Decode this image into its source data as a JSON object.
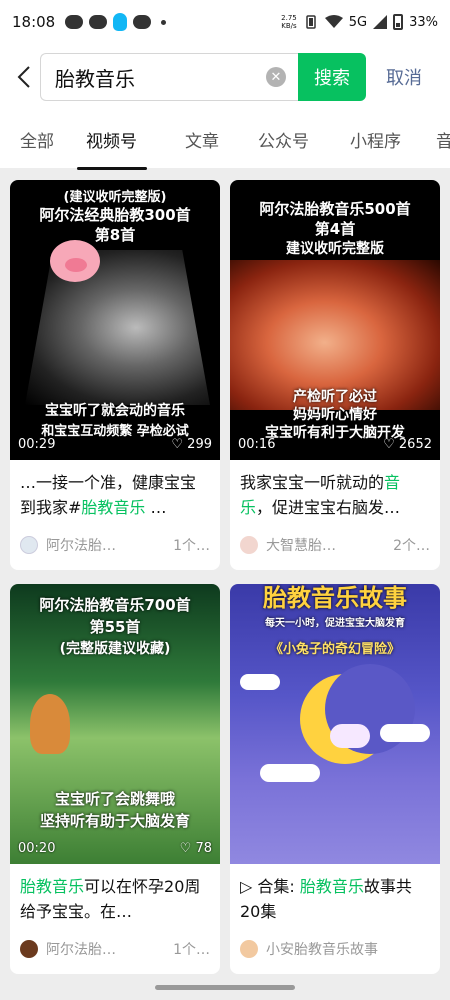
{
  "status": {
    "time": "18:08",
    "speed_top": "2.75",
    "speed_bottom": "KB/s",
    "net": "5G",
    "battery": "33%"
  },
  "search": {
    "query": "胎教音乐",
    "button": "搜索",
    "cancel": "取消"
  },
  "tabs": [
    "全部",
    "视频号",
    "文章",
    "公众号",
    "小程序",
    "音"
  ],
  "active_tab": "视频号",
  "cards": [
    {
      "caption1": "(建议收听完整版)",
      "caption2": "阿尔法经典胎教300首",
      "caption3": "第8首",
      "bottom1": "宝宝听了就会动的音乐",
      "bottom2": "和宝宝互动频繁 孕检必试",
      "duration": "00:29",
      "likes": "299",
      "desc_pre": "…一接一个准，健康宝宝到我家#",
      "desc_hl": "胎教音乐",
      "desc_post": " …",
      "author": "阿尔法胎…",
      "count": "1个…"
    },
    {
      "caption1": "阿尔法胎教音乐500首",
      "caption2": "第4首",
      "caption3": "建议收听完整版",
      "bottom1": "产检听了必过",
      "bottom2": "妈妈听心情好",
      "bottom3": "宝宝听有利于大脑开发",
      "duration": "00:16",
      "likes": "2652",
      "desc_pre": "我家宝宝一听就动的",
      "desc_hl": "音乐",
      "desc_post": "，促进宝宝右脑发…",
      "author": "大智慧胎…",
      "count": "2个…"
    },
    {
      "caption1": "阿尔法胎教音乐700首",
      "caption2": "第55首",
      "caption3": "(完整版建议收藏)",
      "bottom1": "宝宝听了会跳舞哦",
      "bottom2": "坚持听有助于大脑发育",
      "duration": "00:20",
      "likes": "78",
      "desc_pre": "",
      "desc_hl": "胎教音乐",
      "desc_post": "可以在怀孕20周给予宝宝。在…",
      "author": "阿尔法胎…",
      "count": "1个…"
    },
    {
      "caption1": "胎教音乐故事",
      "caption2": "每天一小时，促进宝宝大脑发育",
      "caption3": "《小兔子的奇幻冒险》",
      "desc_pre": "合集: ",
      "desc_hl": "胎教音乐",
      "desc_post": "故事共20集",
      "author": "小安胎教音乐故事"
    }
  ]
}
